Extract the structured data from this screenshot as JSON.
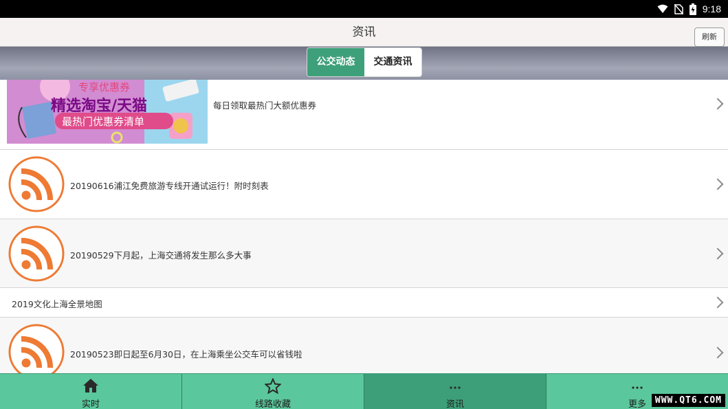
{
  "status_bar": {
    "time": "9:18"
  },
  "header": {
    "title": "资讯",
    "refresh_label": "刷新"
  },
  "tabs": [
    {
      "label": "公交动态",
      "active": true
    },
    {
      "label": "交通资讯",
      "active": false
    }
  ],
  "items": [
    {
      "text": "每日领取最热门大额优惠券",
      "thumb": "banner",
      "banner": {
        "line1": "专享优惠券",
        "line2": "精选淘宝/天猫",
        "line3": "最热门优惠券清单"
      }
    },
    {
      "text": "20190616浦江免费旅游专线开通试运行！附时刻表",
      "thumb": "rss-icon"
    },
    {
      "text": "20190529下月起，上海交通将发生那么多大事",
      "thumb": "rss-icon"
    },
    {
      "text": "2019文化上海全景地图",
      "thumb": "none"
    },
    {
      "text": "20190523即日起至6月30日，在上海乘坐公交车可以省钱啦",
      "thumb": "rss-icon"
    }
  ],
  "bottom_nav": [
    {
      "label": "实时",
      "icon": "home-icon",
      "active": false
    },
    {
      "label": "线路收藏",
      "icon": "star-icon",
      "active": false
    },
    {
      "label": "资讯",
      "icon": "more-dots-icon",
      "active": true
    },
    {
      "label": "更多",
      "icon": "more-dots-icon",
      "active": false
    }
  ],
  "watermark": "WWW.QT6.COM",
  "colors": {
    "accent": "#3da07a",
    "nav_bg": "#5bc79c",
    "rss_orange": "#ee7a33"
  }
}
